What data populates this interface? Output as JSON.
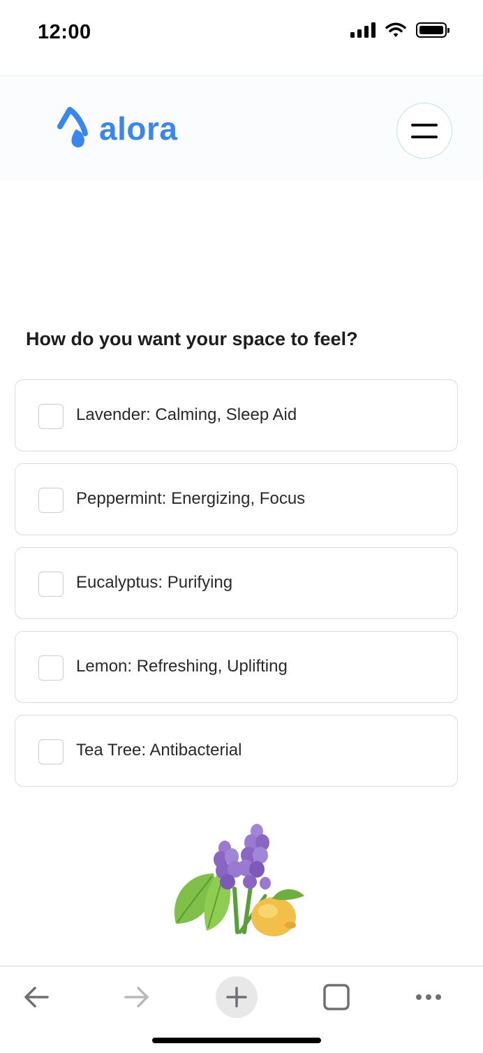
{
  "status_bar": {
    "time": "12:00"
  },
  "header": {
    "logo_text": "alora",
    "brand_color": "#3a86f0",
    "menu_icon": "hamburger-icon"
  },
  "question": {
    "title": "How do you want your space to feel?"
  },
  "options": [
    {
      "label": "Lavender: Calming, Sleep Aid",
      "checked": false
    },
    {
      "label": "Peppermint: Energizing, Focus",
      "checked": false
    },
    {
      "label": "Eucalyptus: Purifying",
      "checked": false
    },
    {
      "label": "Lemon: Refreshing, Uplifting",
      "checked": false
    },
    {
      "label": "Tea Tree: Antibacterial",
      "checked": false
    }
  ],
  "illustration": {
    "icon": "lavender-mint-lemon-illustration"
  },
  "browser_toolbar": {
    "icons": [
      "back-arrow-icon",
      "forward-arrow-icon",
      "plus-icon",
      "tabs-icon",
      "more-icon"
    ]
  }
}
